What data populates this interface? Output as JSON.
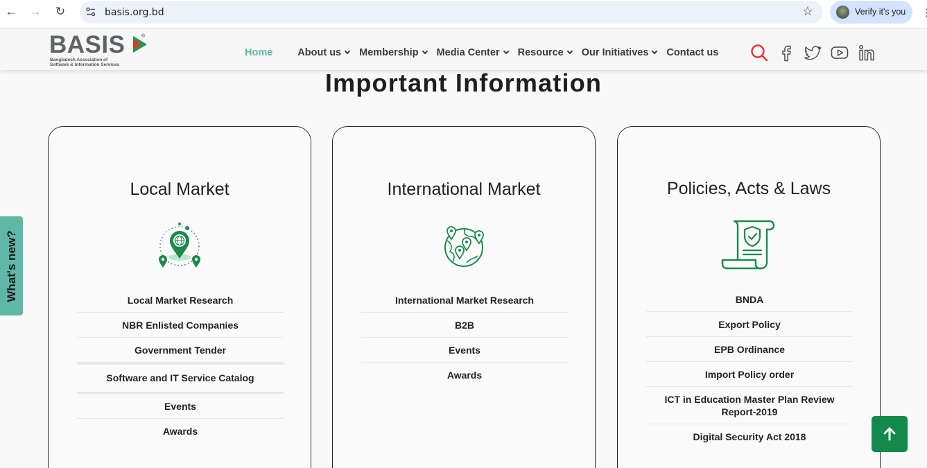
{
  "browser": {
    "url": "basis.org.bd",
    "verify_label": "Verify it's you"
  },
  "header": {
    "logo_text": "BASIS",
    "logo_sub_line1": "Bangladesh Association of",
    "logo_sub_line2": "Software & Information Services",
    "logo_reg": "®",
    "nav": [
      {
        "label": "Home",
        "active": true
      },
      {
        "label": "About us",
        "dropdown": true
      },
      {
        "label": "Membership",
        "dropdown": true
      },
      {
        "label": "Media Center",
        "dropdown": true
      },
      {
        "label": "Resource",
        "dropdown": true
      },
      {
        "label": "Our Initiatives",
        "dropdown": true
      },
      {
        "label": "Contact us"
      }
    ],
    "icons": [
      "search-icon",
      "facebook-icon",
      "twitter-icon",
      "youtube-icon",
      "linkedin-icon"
    ]
  },
  "main": {
    "section_title": "Important Information",
    "cards": [
      {
        "title": "Local Market",
        "icon": "location-pins-icon",
        "links": [
          "Local Market Research",
          "NBR Enlisted Companies",
          "Government Tender",
          "Software and IT Service Catalog",
          "Events",
          "Awards"
        ]
      },
      {
        "title": "International Market",
        "icon": "globe-pins-icon",
        "links": [
          "International Market Research",
          "B2B",
          "Events",
          "Awards"
        ]
      },
      {
        "title": "Policies, Acts & Laws",
        "icon": "policy-scroll-icon",
        "links": [
          "BNDA",
          "Export Policy",
          "EPB Ordinance",
          "Import Policy order",
          "ICT in Education Master Plan Review Report-2019",
          "Digital Security Act 2018"
        ]
      }
    ]
  },
  "side_tab": {
    "label": "What's new?"
  },
  "colors": {
    "accent": "#5fb8a6",
    "brand_green": "#138a4b",
    "search_red": "#e0332f"
  }
}
